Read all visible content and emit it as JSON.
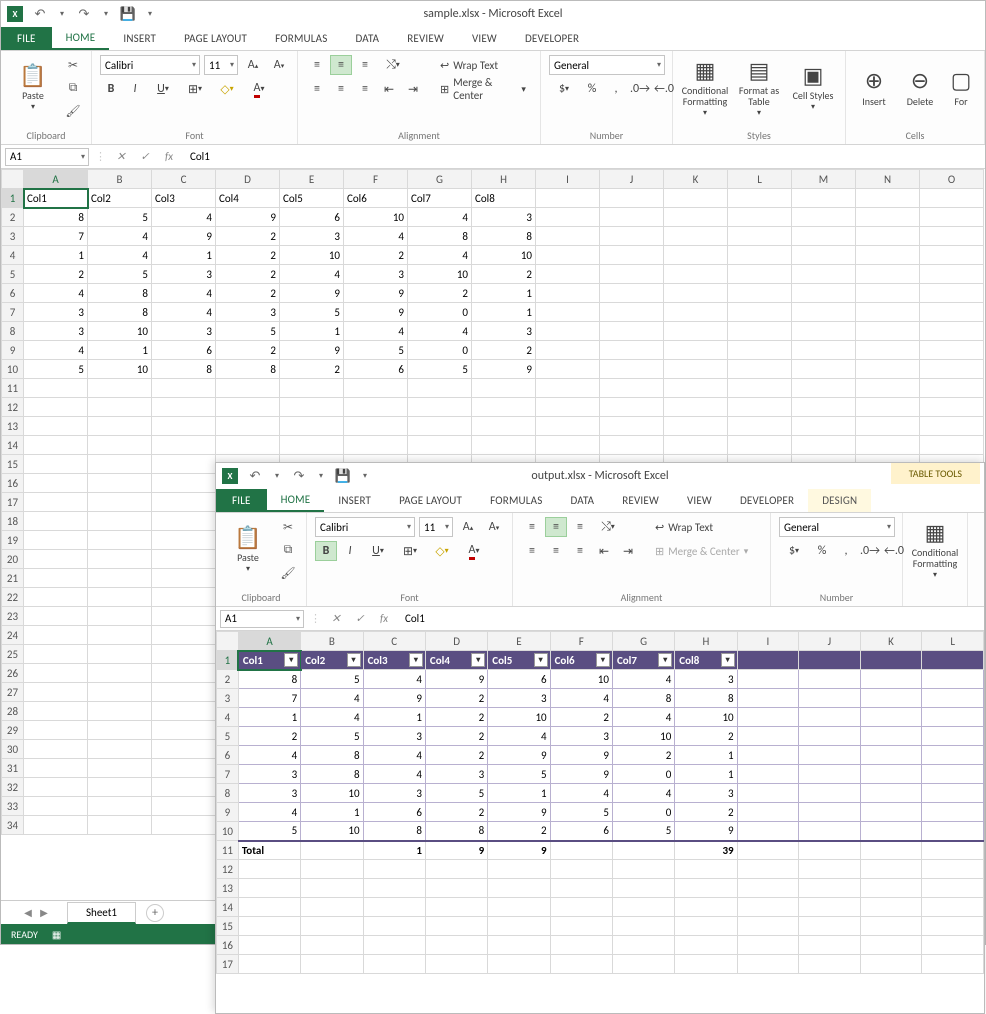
{
  "window1": {
    "title": "sample.xlsx - Microsoft Excel",
    "tabs": {
      "file": "FILE",
      "home": "HOME",
      "insert": "INSERT",
      "pagelayout": "PAGE LAYOUT",
      "formulas": "FORMULAS",
      "data": "DATA",
      "review": "REVIEW",
      "view": "VIEW",
      "developer": "DEVELOPER"
    },
    "ribbon": {
      "clipboard": {
        "paste": "Paste",
        "label": "Clipboard"
      },
      "font": {
        "name": "Calibri",
        "size": "11",
        "label": "Font"
      },
      "alignment": {
        "wrap": "Wrap Text",
        "merge": "Merge & Center",
        "label": "Alignment"
      },
      "number": {
        "format": "General",
        "label": "Number"
      },
      "styles": {
        "cond": "Conditional Formatting",
        "fat": "Format as Table",
        "cell": "Cell Styles",
        "label": "Styles"
      },
      "cells": {
        "insert": "Insert",
        "delete": "Delete",
        "format": "For",
        "label": "Cells"
      }
    },
    "namebox": "A1",
    "formula": "Col1",
    "columns": [
      "A",
      "B",
      "C",
      "D",
      "E",
      "F",
      "G",
      "H",
      "I",
      "J",
      "K",
      "L",
      "M",
      "N",
      "O"
    ],
    "headers": [
      "Col1",
      "Col2",
      "Col3",
      "Col4",
      "Col5",
      "Col6",
      "Col7",
      "Col8"
    ],
    "data": [
      [
        8,
        5,
        4,
        9,
        6,
        10,
        4,
        3
      ],
      [
        7,
        4,
        9,
        2,
        3,
        4,
        8,
        8
      ],
      [
        1,
        4,
        1,
        2,
        10,
        2,
        4,
        10
      ],
      [
        2,
        5,
        3,
        2,
        4,
        3,
        10,
        2
      ],
      [
        4,
        8,
        4,
        2,
        9,
        9,
        2,
        1
      ],
      [
        3,
        8,
        4,
        3,
        5,
        9,
        0,
        1
      ],
      [
        3,
        10,
        3,
        5,
        1,
        4,
        4,
        3
      ],
      [
        4,
        1,
        6,
        2,
        9,
        5,
        0,
        2
      ],
      [
        5,
        10,
        8,
        8,
        2,
        6,
        5,
        9
      ]
    ],
    "sheet": "Sheet1",
    "status": "READY"
  },
  "window2": {
    "title": "output.xlsx - Microsoft Excel",
    "tools_context": "TABLE TOOLS",
    "tabs": {
      "file": "FILE",
      "home": "HOME",
      "insert": "INSERT",
      "pagelayout": "PAGE LAYOUT",
      "formulas": "FORMULAS",
      "data": "DATA",
      "review": "REVIEW",
      "view": "VIEW",
      "developer": "DEVELOPER",
      "design": "DESIGN"
    },
    "ribbon": {
      "clipboard": {
        "paste": "Paste",
        "label": "Clipboard"
      },
      "font": {
        "name": "Calibri",
        "size": "11",
        "label": "Font"
      },
      "alignment": {
        "wrap": "Wrap Text",
        "merge": "Merge & Center",
        "label": "Alignment"
      },
      "number": {
        "format": "General",
        "label": "Number"
      },
      "styles": {
        "cond": "Conditional Formatting"
      }
    },
    "namebox": "A1",
    "formula": "Col1",
    "columns": [
      "A",
      "B",
      "C",
      "D",
      "E",
      "F",
      "G",
      "H",
      "I",
      "J",
      "K",
      "L"
    ],
    "headers": [
      "Col1",
      "Col2",
      "Col3",
      "Col4",
      "Col5",
      "Col6",
      "Col7",
      "Col8"
    ],
    "data": [
      [
        8,
        5,
        4,
        9,
        6,
        10,
        4,
        3
      ],
      [
        7,
        4,
        9,
        2,
        3,
        4,
        8,
        8
      ],
      [
        1,
        4,
        1,
        2,
        10,
        2,
        4,
        10
      ],
      [
        2,
        5,
        3,
        2,
        4,
        3,
        10,
        2
      ],
      [
        4,
        8,
        4,
        2,
        9,
        9,
        2,
        1
      ],
      [
        3,
        8,
        4,
        3,
        5,
        9,
        0,
        1
      ],
      [
        3,
        10,
        3,
        5,
        1,
        4,
        4,
        3
      ],
      [
        4,
        1,
        6,
        2,
        9,
        5,
        0,
        2
      ],
      [
        5,
        10,
        8,
        8,
        2,
        6,
        5,
        9
      ]
    ],
    "total_label": "Total",
    "totals": [
      "",
      "",
      1,
      9,
      9,
      "",
      "",
      39
    ]
  }
}
